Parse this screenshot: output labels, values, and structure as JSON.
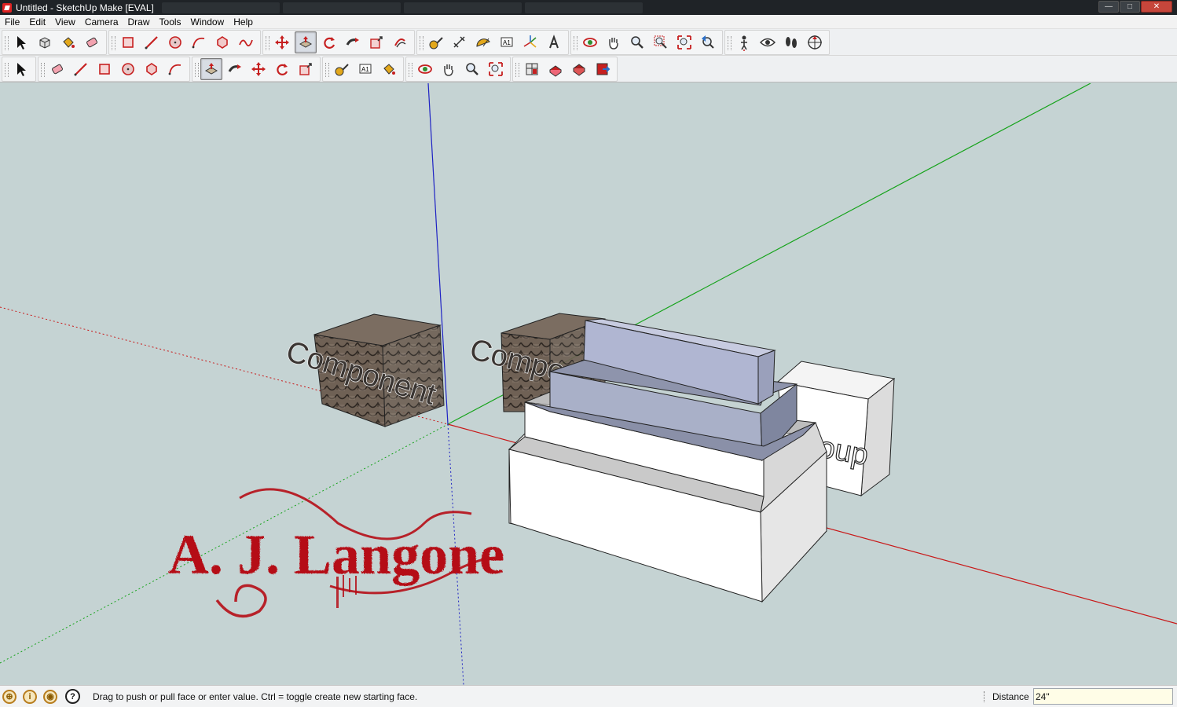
{
  "window": {
    "title": "Untitled - SketchUp Make [EVAL]",
    "controls": {
      "minimize": "—",
      "maximize": "□",
      "close": "✕"
    }
  },
  "menu": [
    "File",
    "Edit",
    "View",
    "Camera",
    "Draw",
    "Tools",
    "Window",
    "Help"
  ],
  "toolbar_large": {
    "groups": [
      [
        "select-tool",
        "make-component-tool",
        "paint-bucket-tool",
        "eraser-tool"
      ],
      [
        "rectangle-tool",
        "line-tool",
        "circle-tool",
        "arc-tool",
        "polygon-tool",
        "freehand-tool"
      ],
      [
        "move-tool",
        "push-pull-tool",
        "rotate-tool",
        "follow-me-tool",
        "scale-tool",
        "offset-tool"
      ],
      [
        "tape-measure-tool",
        "dimension-tool",
        "protractor-tool",
        "text-tool",
        "axes-tool",
        "3d-text-tool"
      ],
      [
        "orbit-tool",
        "pan-tool",
        "zoom-tool",
        "zoom-window-tool",
        "zoom-extents-tool",
        "previous-view-tool"
      ],
      [
        "position-camera-tool",
        "look-around-tool",
        "walk-tool",
        "section-plane-tool"
      ]
    ],
    "active": "push-pull-tool"
  },
  "toolbar_small": {
    "groups": [
      [
        "select-tool"
      ],
      [
        "eraser-tool",
        "line-tool",
        "rectangle-tool",
        "circle-tool",
        "polygon-tool",
        "arc-tool"
      ],
      [
        "push-pull-tool",
        "follow-me-tool",
        "move-tool",
        "rotate-tool",
        "scale-tool"
      ],
      [
        "tape-measure-tool",
        "text-tool",
        "paint-bucket-tool"
      ],
      [
        "orbit-tool",
        "pan-tool",
        "zoom-tool",
        "zoom-extents-tool"
      ],
      [
        "get-models-tool",
        "share-model-tool",
        "share-component-tool",
        "extension-warehouse-tool"
      ]
    ],
    "active": "push-pull-tool"
  },
  "scene": {
    "labels": {
      "component_left": "Component",
      "component_mid": "Compo",
      "group_right": "oup"
    },
    "watermark": "A. J. Langone",
    "colors": {
      "background": "#c5d3d3",
      "red_axis": "#c81818",
      "green_axis": "#16a31b",
      "blue_axis": "#1e22c4",
      "face_front": "#ffffff",
      "face_back": "#a9b0c8",
      "brick": "#6b5d52",
      "watermark": "#b50d16"
    }
  },
  "status": {
    "icons": [
      "geo-location-icon",
      "credits-icon",
      "signin-icon",
      "help-icon"
    ],
    "message": "Drag to push or pull face or enter value.  Ctrl = toggle create new starting face.",
    "measurement_label": "Distance",
    "measurement_value": "24\""
  }
}
